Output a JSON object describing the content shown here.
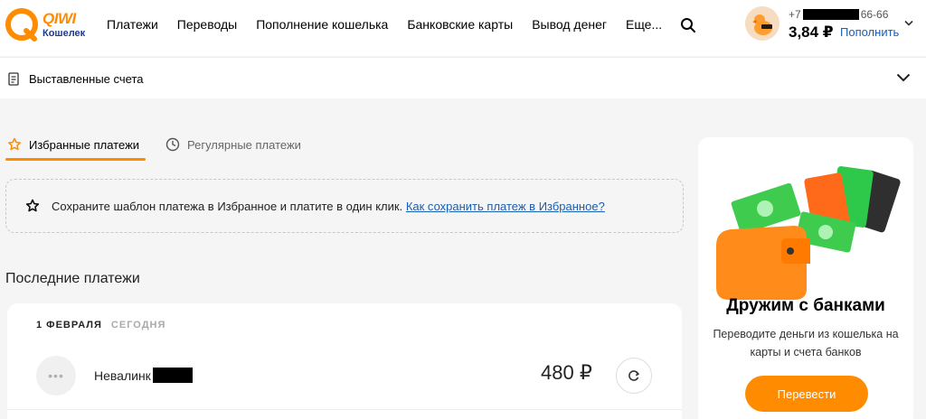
{
  "header": {
    "logo_word": "QIWI",
    "logo_sub": "Кошелек",
    "nav": [
      "Платежи",
      "Переводы",
      "Пополнение кошелька",
      "Банковские карты",
      "Вывод денег",
      "Еще..."
    ],
    "phone_prefix": "+7",
    "phone_suffix": "66-66",
    "balance": "3,84 ₽",
    "topup_label": "Пополнить"
  },
  "invoices": {
    "label": "Выставленные счета"
  },
  "tabs": {
    "favorites": "Избранные платежи",
    "regular": "Регулярные платежи"
  },
  "hint": {
    "text": "Сохраните шаблон платежа в Избранное и платите в один клик.",
    "link": "Как сохранить платеж в Избранное?"
  },
  "recent": {
    "title": "Последние платежи",
    "date": "1 ФЕВРАЛЯ",
    "today": "СЕГОДНЯ",
    "payment": {
      "name": "Невалинк",
      "amount": "480 ₽",
      "avatar_glyph": "•••"
    }
  },
  "promo": {
    "title": "Дружим с банками",
    "text": "Переводите деньги из кошелька на карты и счета банков",
    "button": "Перевести"
  },
  "colors": {
    "accent": "#ff8c00",
    "link": "#1a5fb4",
    "brand_blue": "#1a3a8f"
  },
  "icons": [
    "qiwi-logo-icon",
    "search-icon",
    "chevron-down-icon",
    "receipt-icon",
    "star-icon",
    "clock-icon",
    "repeat-icon"
  ]
}
